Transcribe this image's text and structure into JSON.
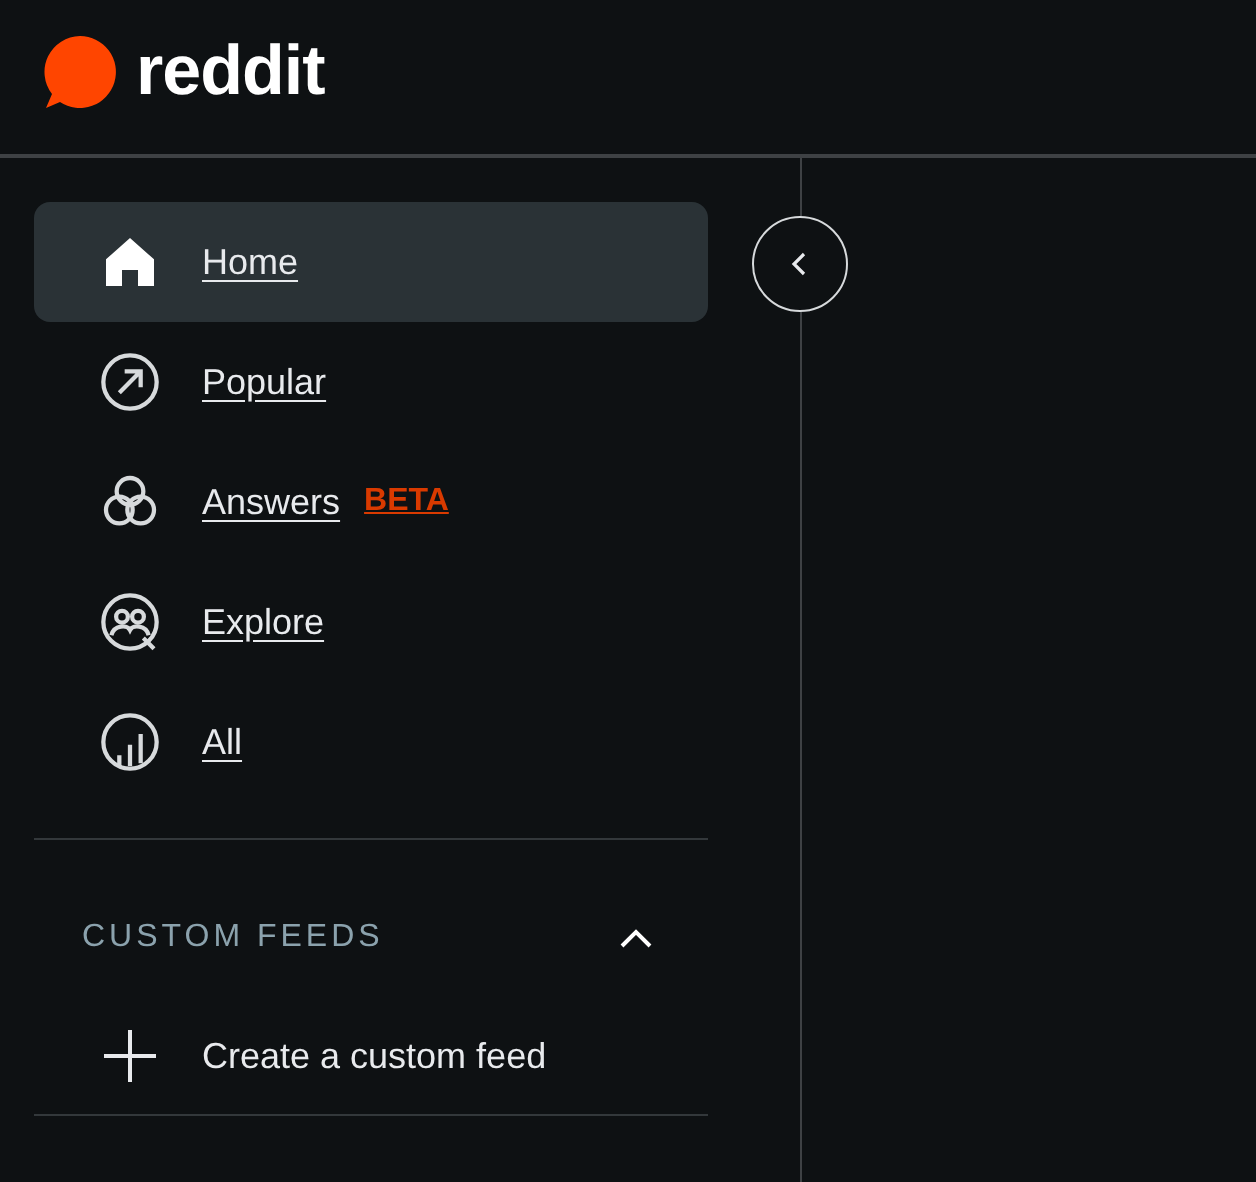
{
  "header": {
    "logo_text": "reddit"
  },
  "nav": [
    {
      "label": "Home",
      "selected": true
    },
    {
      "label": "Popular",
      "selected": false
    },
    {
      "label": "Answers",
      "selected": false,
      "badge": "BETA"
    },
    {
      "label": "Explore",
      "selected": false
    },
    {
      "label": "All",
      "selected": false
    }
  ],
  "custom_feeds": {
    "title": "CUSTOM FEEDS",
    "expanded": true,
    "items": [
      {
        "label": "Create a custom feed"
      }
    ]
  }
}
